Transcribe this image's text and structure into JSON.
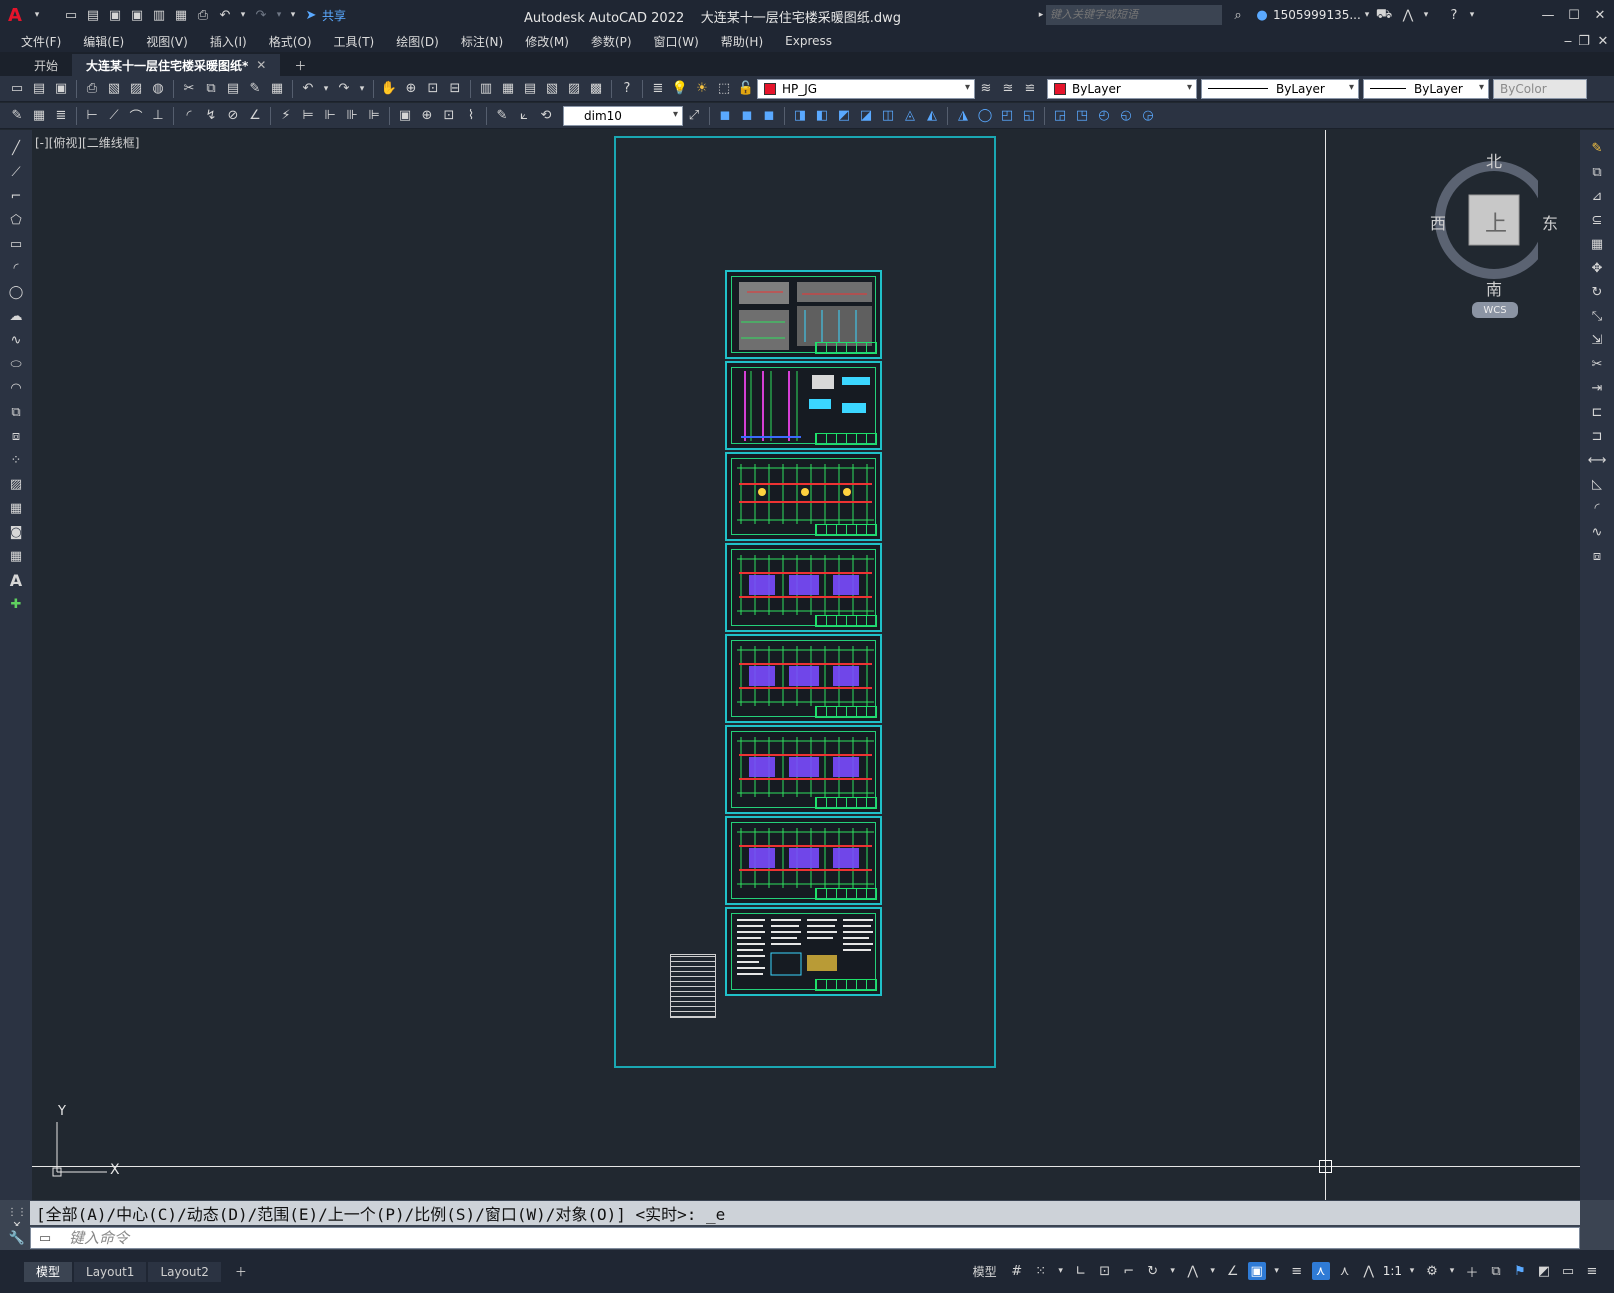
{
  "app": {
    "title": "Autodesk AutoCAD 2022",
    "filename": "大连某十一层住宅楼采暖图纸.dwg",
    "share_label": "共享",
    "search_placeholder": "键入关键字或短语",
    "user": "1505999135...",
    "brand_color": "#e5142b"
  },
  "menu": [
    "文件(F)",
    "编辑(E)",
    "视图(V)",
    "插入(I)",
    "格式(O)",
    "工具(T)",
    "绘图(D)",
    "标注(N)",
    "修改(M)",
    "参数(P)",
    "窗口(W)",
    "帮助(H)",
    "Express"
  ],
  "tabs": [
    {
      "label": "开始"
    },
    {
      "label": "大连某十一层住宅楼采暖图纸*"
    }
  ],
  "properties": {
    "layer": "HP_JG",
    "color": "ByLayer",
    "linetype": "ByLayer",
    "lineweight": "ByLayer",
    "plotstyle": "ByColor",
    "dimstyle": "dim10"
  },
  "viewport": {
    "label": "[-][俯视][二维线框]"
  },
  "viewcube": {
    "north": "北",
    "south": "南",
    "east": "东",
    "west": "西",
    "top": "上",
    "wcs": "WCS"
  },
  "ucs": {
    "x": "X",
    "y": "Y"
  },
  "command": {
    "history": "[全部(A)/中心(C)/动态(D)/范围(E)/上一个(P)/比例(S)/窗口(W)/对象(O)] <实时>: _e",
    "placeholder": "键入命令"
  },
  "layout_tabs": [
    "模型",
    "Layout1",
    "Layout2"
  ],
  "status": {
    "model_label": "模型",
    "scale": "1:1"
  }
}
